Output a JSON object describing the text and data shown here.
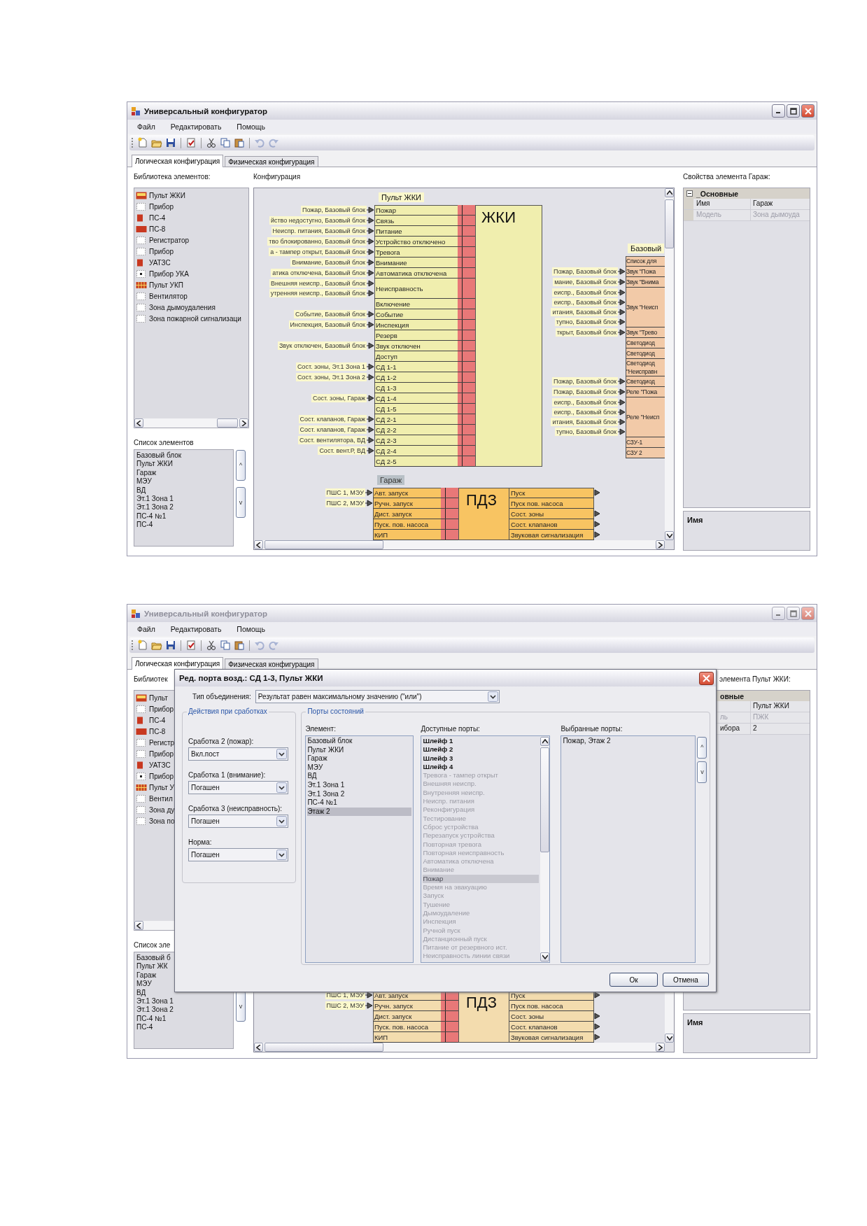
{
  "windows": [
    {
      "title": "Универсальный конфигуратор",
      "active": true,
      "covered": false,
      "menu": [
        "Файл",
        "Редактировать",
        "Помощь"
      ],
      "toolbar": [
        {
          "kind": "new",
          "disabled": false
        },
        {
          "kind": "open",
          "disabled": false
        },
        {
          "kind": "save",
          "disabled": false
        },
        {
          "kind": "separator"
        },
        {
          "kind": "check",
          "disabled": false
        },
        {
          "kind": "separator"
        },
        {
          "kind": "cut",
          "disabled": false
        },
        {
          "kind": "copy",
          "disabled": false
        },
        {
          "kind": "paste",
          "disabled": false
        },
        {
          "kind": "separator"
        },
        {
          "kind": "undo",
          "disabled": true
        },
        {
          "kind": "redo",
          "disabled": true
        }
      ],
      "tabs": [
        {
          "label": "Логическая конфигурация",
          "selected": true
        },
        {
          "label": "Физическая конфигурация",
          "selected": false
        }
      ],
      "library": {
        "label": "Библиотека элементов:",
        "items": [
          {
            "label": "Пульт ЖКИ",
            "kind": "panel"
          },
          {
            "label": "Прибор",
            "kind": "dotted"
          },
          {
            "label": "ПС-4",
            "kind": "square"
          },
          {
            "label": "ПС-8",
            "kind": "wide"
          },
          {
            "label": "Регистратор",
            "kind": "dotted"
          },
          {
            "label": "Прибор",
            "kind": "dotted"
          },
          {
            "label": "УАТЗС",
            "kind": "square"
          },
          {
            "label": "Прибор УКА",
            "kind": "dot"
          },
          {
            "label": "Пульт УКП",
            "kind": "grid"
          },
          {
            "label": "Вентилятор",
            "kind": "dotted"
          },
          {
            "label": "Зона дымоудаления",
            "kind": "dotted"
          },
          {
            "label": "Зона пожарной сигнализаци",
            "kind": "dotted"
          }
        ]
      },
      "elements": {
        "label": "Список элементов",
        "items": [
          "Базовый блок",
          "Пульт ЖКИ",
          "Гараж",
          "МЭУ",
          "ВД",
          "Эт.1 Зона 1",
          "Эт.1 Зона 2",
          "ПС-4 №1",
          "ПС-4"
        ],
        "buttons": [
          {
            "kind": "up",
            "label": "^"
          },
          {
            "kind": "down",
            "label": "v"
          }
        ]
      },
      "config": {
        "label": "Конфигурация",
        "blocks": [
          {
            "kind": "lcd",
            "caption": "Пульт ЖКИ",
            "title": "ЖКИ",
            "inputs": [
              {
                "label": "Пожар",
                "sources": [
                  "Пожар, Базовый блок"
                ]
              },
              {
                "label": "Связь",
                "sources": [
                  "йство недостугно, Базовый блок"
                ]
              },
              {
                "label": "Питание",
                "sources": [
                  "Неиспр. питания, Базовый блок"
                ]
              },
              {
                "label": "Устройство отключено",
                "sources": [
                  "тво блокированно, Базовый блок"
                ]
              },
              {
                "label": "Тревога",
                "sources": [
                  "а - тампер открыт, Базовый блок"
                ]
              },
              {
                "label": "Внимание",
                "sources": [
                  "Внимание, Базовый блок"
                ]
              },
              {
                "label": "Автоматика отключена",
                "sources": [
                  "атика отключена, Базовый блок"
                ]
              },
              {
                "label": "Неисправность",
                "sources": [
                  "Внешняя неиспр., Базовый блок",
                  "утренняя неиспр., Базовый блок"
                ]
              },
              {
                "label": "Включение"
              },
              {
                "label": "Событие",
                "sources": [
                  "Событие, Базовый блок"
                ]
              },
              {
                "label": "Инспекция",
                "sources": [
                  "Инспекция, Базовый блок"
                ]
              },
              {
                "label": "Резерв"
              },
              {
                "label": "Звук отключен",
                "sources": [
                  "Звук отключен, Базовый блок"
                ]
              },
              {
                "label": "Доступ"
              },
              {
                "label": "СД 1-1",
                "sources": [
                  "Сост. зоны, Эт.1 Зона 1"
                ]
              },
              {
                "label": "СД 1-2",
                "sources": [
                  "Сост. зоны, Эт.1 Зона 2"
                ]
              },
              {
                "label": "СД 1-3"
              },
              {
                "label": "СД 1-4",
                "sources": [
                  "Сост. зоны, Гараж"
                ]
              },
              {
                "label": "СД 1-5"
              },
              {
                "label": "СД 2-1",
                "sources": [
                  "Сост. клапанов, Гараж"
                ]
              },
              {
                "label": "СД 2-2",
                "sources": [
                  "Сост. клапанов, Гараж"
                ]
              },
              {
                "label": "СД 2-3",
                "sources": [
                  "Сост. вентилятора, ВД"
                ]
              },
              {
                "label": "СД 2-4",
                "sources": [
                  "Сост. вент.Р, ВД"
                ]
              },
              {
                "label": "СД 2-5"
              }
            ]
          },
          {
            "kind": "device",
            "caption": "Базовый",
            "inputs": [
              {
                "label": "Список для"
              },
              {
                "label": "Звук \"Пожа",
                "sources": [
                  "Пожар, Базовый блок"
                ]
              },
              {
                "label": "Звук \"Внима",
                "sources": [
                  "мание, Базовый блок"
                ]
              },
              {
                "label": "Звук \"Неисп",
                "sources": [
                  "еиспр., Базовый блок",
                  "еиспр., Базовый блок",
                  "итания, Базовый блок",
                  "тупно, Базовый блок"
                ]
              },
              {
                "label": "Звук \"Трево",
                "sources": [
                  "ткрыт, Базовый блок"
                ]
              },
              {
                "label": "Светодиод"
              },
              {
                "label": "Светодиод"
              },
              {
                "label": "Светодиод \"Неисправн"
              },
              {
                "label": "Светодиод",
                "sources": [
                  "Пожар, Базовый блок"
                ]
              },
              {
                "label": "Реле \"Пожа",
                "sources": [
                  "Пожар, Базовый блок"
                ]
              },
              {
                "label": "Реле \"Неисп",
                "sources": [
                  "еиспр., Базовый блок",
                  "еиспр., Базовый блок",
                  "итания, Базовый блок",
                  "тупно, Базовый блок"
                ]
              },
              {
                "label": "СЗУ-1"
              },
              {
                "label": "СЗУ 2"
              }
            ]
          },
          {
            "kind": "module",
            "caption": "Гараж",
            "title": "ПДЗ",
            "highlighted": true,
            "inputs": [
              {
                "label": "Авт. запуск",
                "sources": [
                  "ПШС 1, МЭУ"
                ]
              },
              {
                "label": "Ручн. запуск",
                "sources": [
                  "ПШС 2, МЭУ"
                ]
              },
              {
                "label": "Дист. запуск"
              },
              {
                "label": "Пуск. пов. насоса"
              },
              {
                "label": "КИП"
              }
            ],
            "outputs": [
              {
                "label": "Пуск",
                "linked": true
              },
              {
                "label": "Пуск пов. насоса",
                "linked": false
              },
              {
                "label": "Сост. зоны",
                "linked": true
              },
              {
                "label": "Сост. клапанов",
                "linked": true
              },
              {
                "label": "Звуковая сигнализация",
                "linked": true
              }
            ]
          }
        ]
      },
      "properties": {
        "label": "Свойства элемента Гараж:",
        "group": "_Основные",
        "rows": [
          {
            "name": "Имя",
            "value": "Гараж",
            "readonly": false
          },
          {
            "name": "Модель",
            "value": "Зона дымоуда",
            "readonly": true
          }
        ],
        "help": "Имя"
      }
    },
    {
      "title": "Универсальный конфигуратор",
      "active": false,
      "covered": true,
      "menu": [
        "Файл",
        "Редактировать",
        "Помощь"
      ],
      "toolbar": [
        {
          "kind": "new",
          "disabled": false
        },
        {
          "kind": "open",
          "disabled": false
        },
        {
          "kind": "save",
          "disabled": false
        },
        {
          "kind": "separator"
        },
        {
          "kind": "check",
          "disabled": false
        },
        {
          "kind": "separator"
        },
        {
          "kind": "cut",
          "disabled": false
        },
        {
          "kind": "copy",
          "disabled": false
        },
        {
          "kind": "paste",
          "disabled": false
        },
        {
          "kind": "separator"
        },
        {
          "kind": "undo",
          "disabled": true
        },
        {
          "kind": "redo",
          "disabled": true
        }
      ],
      "tabs": [
        {
          "label": "Логическая конфигурация",
          "selected": true
        },
        {
          "label": "Физическая конфигурация",
          "selected": false
        }
      ],
      "library": {
        "label": "Библиотек",
        "items": [
          {
            "label": "Пульт",
            "kind": "panel"
          },
          {
            "label": "Прибор",
            "kind": "dotted"
          },
          {
            "label": "ПС-4",
            "kind": "square"
          },
          {
            "label": "ПС-8",
            "kind": "wide"
          },
          {
            "label": "Регистр",
            "kind": "dotted"
          },
          {
            "label": "Прибор",
            "kind": "dotted"
          },
          {
            "label": "УАТЗС",
            "kind": "square"
          },
          {
            "label": "Прибор",
            "kind": "dot"
          },
          {
            "label": "Пульт У",
            "kind": "grid"
          },
          {
            "label": "Вентил",
            "kind": "dotted"
          },
          {
            "label": "Зона ду",
            "kind": "dotted"
          },
          {
            "label": "Зона по",
            "kind": "dotted"
          }
        ]
      },
      "elements": {
        "label": "Список эле",
        "items": [
          "Базовый б",
          "Пульт ЖК",
          "Гараж",
          "МЭУ",
          "ВД",
          "Эт.1 Зона 1",
          "Эт.1 Зона 2",
          "ПС-4 №1",
          "ПС-4"
        ],
        "buttons": [
          {
            "kind": "down",
            "label": "v"
          }
        ]
      },
      "config": {
        "blocks": [
          {
            "kind": "module",
            "title": "ПДЗ",
            "highlighted": false,
            "inputs": [
              {
                "label": "Авт. запуск",
                "sources": [
                  "ПШС 1, МЭУ"
                ]
              },
              {
                "label": "Ручн. запуск",
                "sources": [
                  "ПШС 2, МЭУ"
                ]
              },
              {
                "label": "Дист. запуск"
              },
              {
                "label": "Пуск. пов. насоса"
              },
              {
                "label": "КИП"
              }
            ],
            "outputs": [
              {
                "label": "Пуск",
                "linked": true
              },
              {
                "label": "Пуск пов. насоса",
                "linked": false
              },
              {
                "label": "Сост. зоны",
                "linked": true
              },
              {
                "label": "Сост. клапанов",
                "linked": true
              },
              {
                "label": "Звуковая сигнализация",
                "linked": true
              }
            ]
          }
        ]
      },
      "properties": {
        "label": "элемента Пульт ЖКИ:",
        "group": "овные",
        "rows": [
          {
            "value": "Пульт ЖКИ",
            "readonly": false
          },
          {
            "name": "ль",
            "value": "ПЖК",
            "readonly": true
          },
          {
            "name": "ибора",
            "value": "2",
            "readonly": false
          }
        ],
        "help": "Имя"
      },
      "dialog": {
        "title": "Ред. порта возд.: СД 1-3, Пульт ЖКИ",
        "merge": {
          "label": "Тип объединения:",
          "value": "Результат равен максимальному значению (\"или\")"
        },
        "actions": {
          "title": "Действия при сработках",
          "fields": [
            {
              "label": "Сработка 2 (пожар):",
              "value": "Вкл.пост"
            },
            {
              "label": "Сработка 1 (внимание):",
              "value": "Погашен"
            },
            {
              "label": "Сработка 3 (неисправность):",
              "value": "Погашен"
            },
            {
              "label": "Норма:",
              "value": "Погашен"
            }
          ]
        },
        "ports": {
          "title": "Порты состояний",
          "element": {
            "label": "Элемент:",
            "items": [
              {
                "label": "Базовый блок",
                "selected": false
              },
              {
                "label": "Пульт ЖКИ",
                "selected": false
              },
              {
                "label": "Гараж",
                "selected": false
              },
              {
                "label": "МЭУ",
                "selected": false
              },
              {
                "label": "ВД",
                "selected": false
              },
              {
                "label": "Эт.1 Зона 1",
                "selected": false
              },
              {
                "label": "Эт.1 Зона 2",
                "selected": false
              },
              {
                "label": "ПС-4 №1",
                "selected": false
              },
              {
                "label": "Этаж 2",
                "selected": true
              }
            ]
          },
          "available": {
            "label": "Доступные порты:",
            "items": [
              {
                "label": "Шлейф 1",
                "enabled": true,
                "selected": false
              },
              {
                "label": "Шлейф 2",
                "enabled": true,
                "selected": false
              },
              {
                "label": "Шлейф 3",
                "enabled": true,
                "selected": false
              },
              {
                "label": "Шлейф 4",
                "enabled": true,
                "selected": false
              },
              {
                "label": "Тревога - тампер открыт",
                "enabled": false,
                "selected": false
              },
              {
                "label": "Внешняя неиспр.",
                "enabled": false,
                "selected": false
              },
              {
                "label": "Внутренняя неиспр.",
                "enabled": false,
                "selected": false
              },
              {
                "label": "Неиспр. питания",
                "enabled": false,
                "selected": false
              },
              {
                "label": "Реконфигурация",
                "enabled": false,
                "selected": false
              },
              {
                "label": "Тестирование",
                "enabled": false,
                "selected": false
              },
              {
                "label": "Сброс устройства",
                "enabled": false,
                "selected": false
              },
              {
                "label": "Перезапуск устройства",
                "enabled": false,
                "selected": false
              },
              {
                "label": "Повторная тревога",
                "enabled": false,
                "selected": false
              },
              {
                "label": "Повторная неисправность",
                "enabled": false,
                "selected": false
              },
              {
                "label": "Автоматика отключена",
                "enabled": false,
                "selected": false
              },
              {
                "label": "Внимание",
                "enabled": false,
                "selected": false
              },
              {
                "label": "Пожар",
                "enabled": false,
                "selected": true
              },
              {
                "label": "Время на эвакуацию",
                "enabled": false,
                "selected": false
              },
              {
                "label": "Запуск",
                "enabled": false,
                "selected": false
              },
              {
                "label": "Тушение",
                "enabled": false,
                "selected": false
              },
              {
                "label": "Дымоудаление",
                "enabled": false,
                "selected": false
              },
              {
                "label": "Инспекция",
                "enabled": false,
                "selected": false
              },
              {
                "label": "Ручной пуск",
                "enabled": false,
                "selected": false
              },
              {
                "label": "Дистанционный пуск",
                "enabled": false,
                "selected": false
              },
              {
                "label": "Питание от резервного ист.",
                "enabled": false,
                "selected": false
              },
              {
                "label": "Неисправность линии связи",
                "enabled": false,
                "selected": false
              }
            ]
          },
          "chosen": {
            "label": "Выбранные порты:",
            "items": [
              "Пожар, Этаж 2"
            ],
            "buttons": [
              "^",
              "v"
            ]
          }
        },
        "buttons": [
          "Ок",
          "Отмена"
        ]
      }
    }
  ]
}
